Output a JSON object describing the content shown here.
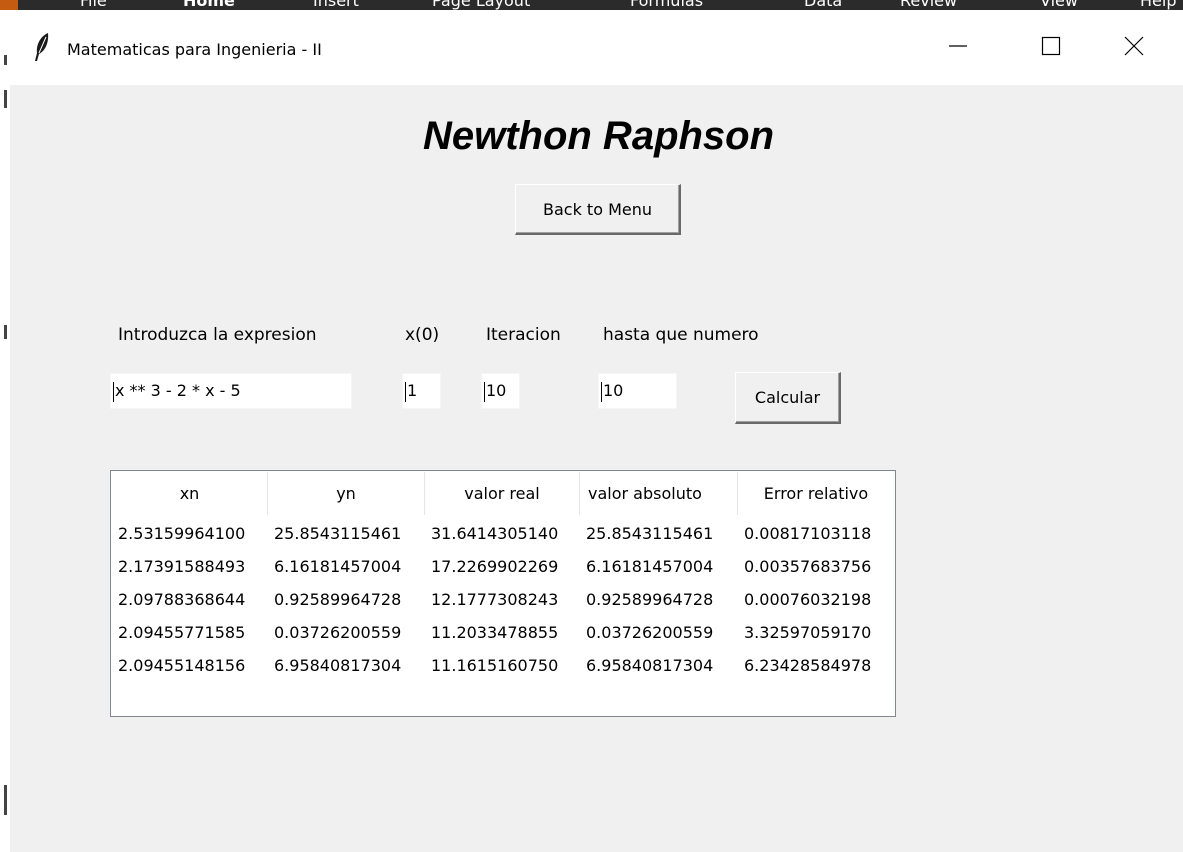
{
  "background_app": {
    "ribbon_tabs": [
      "File",
      "Home",
      "Insert",
      "Page Layout",
      "Formulas",
      "Data",
      "Review",
      "View",
      "Help"
    ]
  },
  "window": {
    "title": "Matematicas para Ingenieria - II",
    "icon": "feather-icon",
    "controls": {
      "minimize": "minimize-icon",
      "maximize": "maximize-icon",
      "close": "close-icon"
    }
  },
  "page": {
    "heading": "Newthon Raphson",
    "back_button_label": "Back to Menu"
  },
  "form": {
    "expression_label": "Introduzca la expresion",
    "expression_value": "x ** 3 - 2 * x - 5",
    "x0_label": "x(0)",
    "x0_value": "1",
    "iteration_label": "Iteracion",
    "iteration_value": "10",
    "until_label": "hasta que numero",
    "until_value": "10",
    "calculate_label": "Calcular"
  },
  "table": {
    "columns": [
      "xn",
      "yn",
      "valor real",
      "valor absoluto",
      "Error relativo"
    ],
    "rows": [
      [
        "2.53159964100",
        "25.8543115461",
        "31.6414305140",
        "25.8543115461",
        "0.00817103118"
      ],
      [
        "2.17391588493",
        "6.16181457004",
        "17.2269902269",
        "6.16181457004",
        "0.00357683756"
      ],
      [
        "2.09788368644",
        "0.92589964728",
        "12.1777308243",
        "0.92589964728",
        "0.00076032198"
      ],
      [
        "2.09455771585",
        "0.03726200559",
        "11.2033478855",
        "0.03726200559",
        "3.32597059170"
      ],
      [
        "2.09455148156",
        "6.95840817304",
        "11.1615160750",
        "6.95840817304",
        "6.23428584978"
      ]
    ]
  },
  "colors": {
    "window_bg": "#f0f0f0",
    "titlebar_bg": "#ffffff",
    "table_border": "#828790",
    "ribbon_bg": "#2b2b2b",
    "ribbon_accent": "#c55a11"
  }
}
